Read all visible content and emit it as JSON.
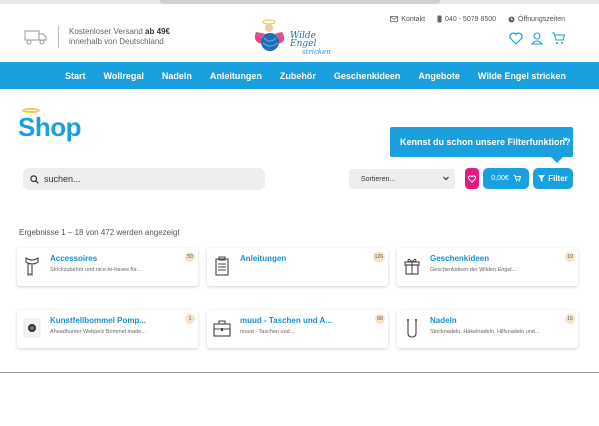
{
  "header": {
    "shipping_line1": "Kostenloser Versand ",
    "shipping_amount": "ab 49€",
    "shipping_line2": "innerhalb von Deutschland",
    "logo_line1": "Wilde Engel",
    "logo_line2": "stricken",
    "contact_label": "Kontakt",
    "phone": "040 - 5079 8500",
    "hours_label": "Öffnungszeiten"
  },
  "nav": {
    "items": [
      "Start",
      "Wollregal",
      "Nadeln",
      "Anleitungen",
      "Zubehör",
      "Geschenkideen",
      "Angebote",
      "Wilde Engel stricken"
    ]
  },
  "page": {
    "title": "Shop",
    "tooltip": "Kennst du schon unsere Filterfunktion?",
    "tooltip_close": "×",
    "search_placeholder": "suchen...",
    "sort_label": "Sortieren...",
    "cart_total": "0,00€",
    "filter_label": "Filter",
    "results_text": "Ergebnisse 1 – 18 von 472 werden angezeigt"
  },
  "categories": [
    {
      "title": "Accessoires",
      "desc": "Strickzubehör und nice-to-haves für...",
      "count": "50",
      "icon": "scarf-icon"
    },
    {
      "title": "Anleitungen",
      "desc": "",
      "count": "126",
      "icon": "clipboard-icon"
    },
    {
      "title": "Geschenkideen",
      "desc": "Geschenkideen der Wilden Engel....",
      "count": "19",
      "icon": "gift-icon"
    },
    {
      "title": "Kunstfellbommel Pomp...",
      "desc": "Ahead­hunter Webpelz Bommel made...",
      "count": "1",
      "icon": "pompom-product-icon"
    },
    {
      "title": "muud - Taschen und A...",
      "desc": "muud - Taschen und...",
      "count": "68",
      "icon": "bag-icon"
    },
    {
      "title": "Nadeln",
      "desc": "Stricknadeln, Häkelnadeln, Hilfsnadeln und...",
      "count": "16",
      "icon": "needles-icon"
    }
  ],
  "colors": {
    "brand": "#1aa0de",
    "wishlist": "#e5197f",
    "badge": "#f6e3c8"
  }
}
